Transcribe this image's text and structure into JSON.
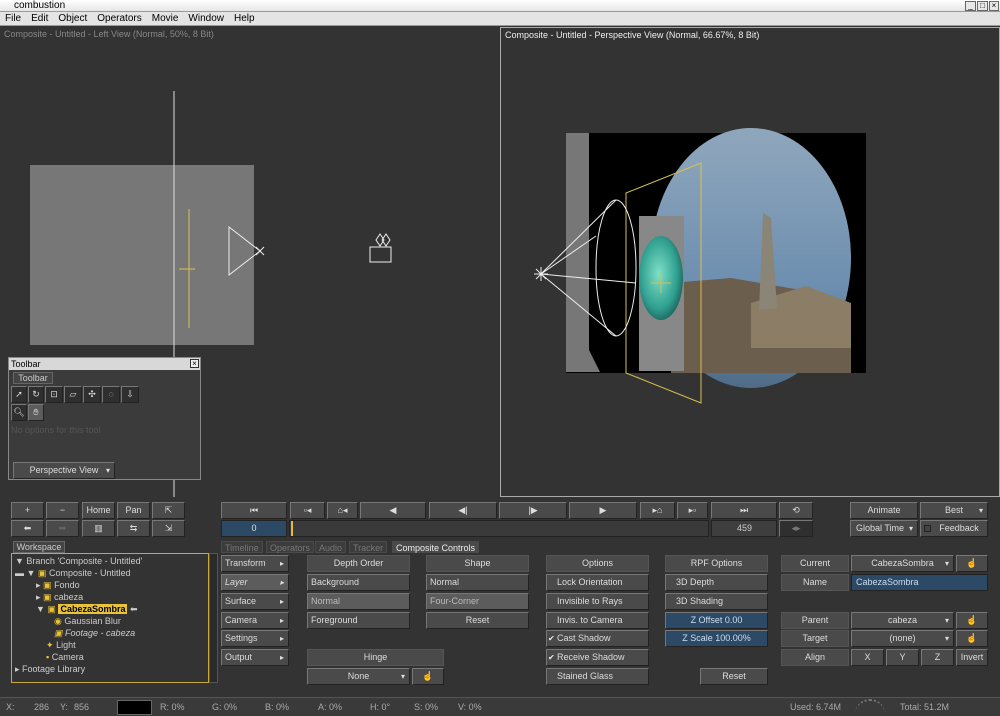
{
  "app": {
    "title": "combustion"
  },
  "menu": [
    "File",
    "Edit",
    "Object",
    "Operators",
    "Movie",
    "Window",
    "Help"
  ],
  "left_view": {
    "label": "Composite - Untitled - Left View (Normal, 50%, 8 Bit)"
  },
  "right_view": {
    "label": "Composite - Untitled - Perspective View (Normal, 66.67%, 8 Bit)"
  },
  "toolbar_panel": {
    "title": "Toolbar",
    "tab": "Toolbar",
    "no_options": "No options for this tool",
    "view_select": "Perspective View"
  },
  "nav": {
    "plus": "+",
    "minus": "−",
    "home": "Home",
    "pan": "Pan"
  },
  "timeline": {
    "current_frame": "0",
    "end_frame": "459"
  },
  "right_controls": {
    "animate": "Animate",
    "best": "Best",
    "global_time": "Global Time",
    "feedback": "Feedback"
  },
  "workspace": {
    "tab": "Workspace",
    "items": {
      "branch": "Branch 'Composite - Untitled'",
      "composite": "Composite - Untitled",
      "fondo": "Fondo",
      "cabeza": "cabeza",
      "cabezasombra": "CabezaSombra",
      "gaussian": "Gaussian Blur",
      "footage": "Footage - cabeza",
      "light": "Light",
      "camera": "Camera",
      "library": "Footage Library"
    }
  },
  "panel_tabs": [
    "Timeline",
    "Operators",
    "Audio",
    "Tracker",
    "Composite Controls"
  ],
  "categories": [
    "Transform",
    "Layer",
    "Surface",
    "Camera",
    "Settings",
    "Output"
  ],
  "depth_order": {
    "title": "Depth Order",
    "items": [
      "Background",
      "Normal",
      "Foreground"
    ]
  },
  "shape": {
    "title": "Shape",
    "items": [
      "Normal",
      "Four-Corner"
    ],
    "reset": "Reset"
  },
  "hinge": {
    "title": "Hinge",
    "value": "None"
  },
  "options": {
    "title": "Options",
    "items": [
      "Lock Orientation",
      "Invisible to Rays",
      "Invis. to Camera",
      "Cast Shadow",
      "Receive Shadow",
      "Stained Glass"
    ]
  },
  "rpf": {
    "title": "RPF Options",
    "depth": "3D Depth",
    "shading": "3D Shading",
    "zoffset": "Z Offset 0.00",
    "zscale": "Z Scale 100.00%",
    "reset": "Reset"
  },
  "props": {
    "current_label": "Current",
    "current_value": "CabezaSombra",
    "name_label": "Name",
    "name_value": "CabezaSombra",
    "parent_label": "Parent",
    "parent_value": "cabeza",
    "target_label": "Target",
    "target_value": "(none)",
    "align_label": "Align",
    "x": "X",
    "y": "Y",
    "z": "Z",
    "invert": "Invert"
  },
  "status": {
    "x": "X:",
    "x_val": "286",
    "y": "Y:",
    "y_val": "856",
    "r": "R: 0%",
    "g": "G: 0%",
    "b": "B: 0%",
    "a": "A: 0%",
    "h": "H: 0°",
    "s": "S: 0%",
    "v": "V: 0%",
    "used": "Used: 6.74M",
    "total": "Total: 51.2M"
  }
}
